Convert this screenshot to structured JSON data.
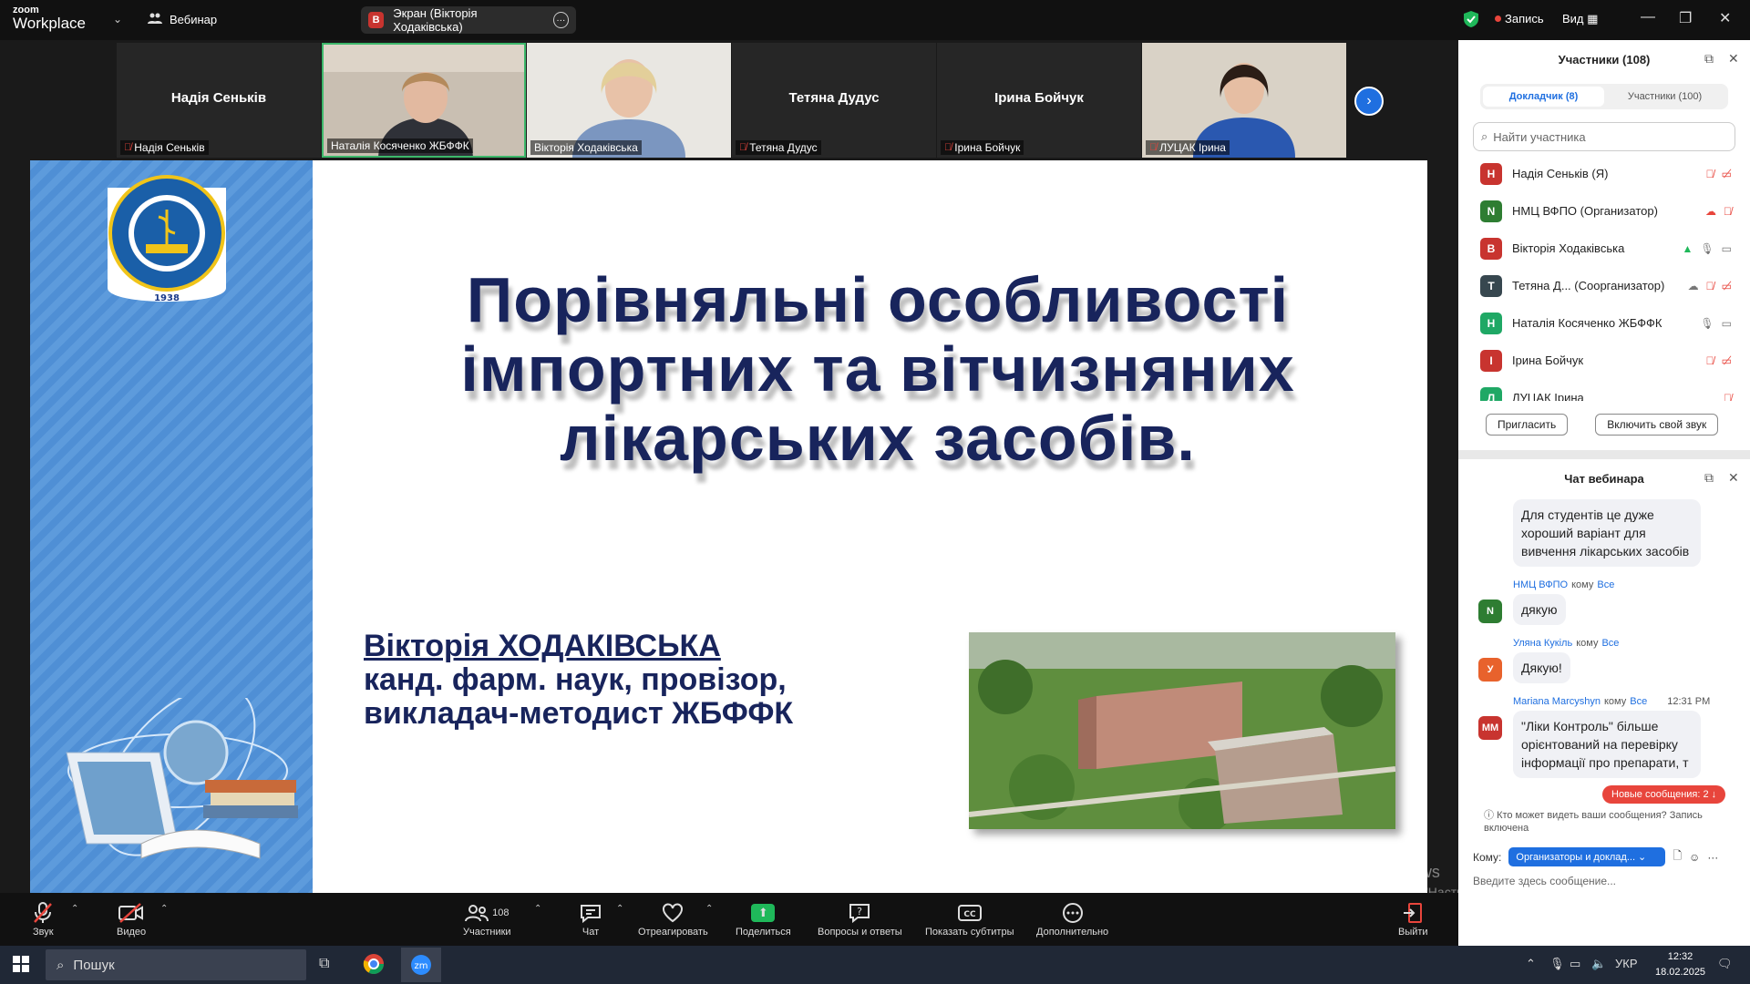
{
  "app": {
    "brand_top": "zoom",
    "brand_bottom": "Workplace",
    "webinar_label": "Вебинар",
    "share_badge": "В",
    "share_title": "Экран (Вікторія Ходаківська)",
    "record_label": "Запись",
    "view_label": "Вид"
  },
  "tiles": [
    {
      "name": "Надія Сеньків",
      "label": "Надія Сеньків",
      "video": false,
      "muted": true
    },
    {
      "name": "",
      "label": "Наталія Косяченко ЖБФФК",
      "video": true,
      "muted": false,
      "active": true
    },
    {
      "name": "",
      "label": "Вікторія Ходаківська",
      "video": true,
      "muted": false
    },
    {
      "name": "Тетяна Дудус",
      "label": "Тетяна Дудус",
      "video": false,
      "muted": true
    },
    {
      "name": "Ірина Бойчук",
      "label": "Ірина Бойчук",
      "video": false,
      "muted": true
    },
    {
      "name": "",
      "label": "ЛУЦАК Ірина",
      "video": true,
      "muted": true
    }
  ],
  "slide": {
    "title_lines": [
      "Порівняльні особливості",
      "імпортних та вітчизняних",
      "лікарських засобів."
    ],
    "author_name": "Вікторія ХОДАКІВСЬКА",
    "author_line2": "канд. фарм. наук, провізор,",
    "author_line3": "викладач-методист ЖБФФК",
    "logo_year": "1938"
  },
  "toolbar": {
    "audio": "Звук",
    "video": "Видео",
    "participants": "Участники",
    "participants_count": "108",
    "chat": "Чат",
    "react": "Отреагировать",
    "share": "Поделиться",
    "qa": "Вопросы и ответы",
    "captions": "Показать субтитры",
    "more": "Дополнительно",
    "leave": "Выйти"
  },
  "watermark": {
    "line1": "Активація Windows",
    "line2": "Перейдіть до розділу \"Настройки\", щоб активувати Windows."
  },
  "participants_panel": {
    "title": "Участники (108)",
    "tab_presenters": "Докладчик (8)",
    "tab_attendees": "Участники (100)",
    "search_placeholder": "Найти участника",
    "rows": [
      {
        "initial": "Н",
        "color": "#c8342f",
        "name": "Надія Сеньків (Я)"
      },
      {
        "initial": "N",
        "color": "#2e7d32",
        "name": "НМЦ ВФПО (Организатор)"
      },
      {
        "initial": "В",
        "color": "#c8342f",
        "name": "Вікторія Ходаківська"
      },
      {
        "initial": "Т",
        "color": "#37474f",
        "name": "Тетяна Д... (Соорганизатор)"
      },
      {
        "initial": "Н",
        "color": "#1fa865",
        "name": "Наталія Косяченко ЖБФФК"
      },
      {
        "initial": "І",
        "color": "#c8342f",
        "name": "Ірина Бойчук"
      },
      {
        "initial": "Л",
        "color": "#1fa865",
        "name": "ЛУЦАК Ірина"
      }
    ],
    "invite_button": "Пригласить",
    "unmute_button": "Включить свой звук"
  },
  "chat_panel": {
    "title": "Чат вебинара",
    "messages": [
      {
        "sender": "",
        "to": "",
        "time": "",
        "initial": "",
        "color": "",
        "text": "Для студентів це дуже хороший варіант для вивчення лікарських засобів"
      },
      {
        "sender": "НМЦ ВФПО",
        "to": "Все",
        "time": "",
        "initial": "N",
        "color": "#2e7d32",
        "text": "дякую"
      },
      {
        "sender": "Уляна Кукіль",
        "to": "Все",
        "time": "",
        "initial": "У",
        "color": "#e8622c",
        "text": "Дякую!"
      },
      {
        "sender": "Mariana Marcyshyn",
        "to": "Все",
        "time": "12:31 PM",
        "initial": "MM",
        "color": "#c8342f",
        "text": "\"Ліки Контроль\" більше орієнтований на перевірку інформації про препарати, т"
      }
    ],
    "to_word": "кому",
    "new_messages": "Новые сообщения: 2",
    "who_sees": "Кто может видеть ваши сообщения? Запись включена",
    "to_label": "Кому:",
    "to_value": "Организаторы и доклад...",
    "compose_placeholder": "Введите здесь сообщение..."
  },
  "taskbar": {
    "search_label": "Пошук",
    "lang": "УКР",
    "time": "12:32",
    "date": "18.02.2025"
  }
}
